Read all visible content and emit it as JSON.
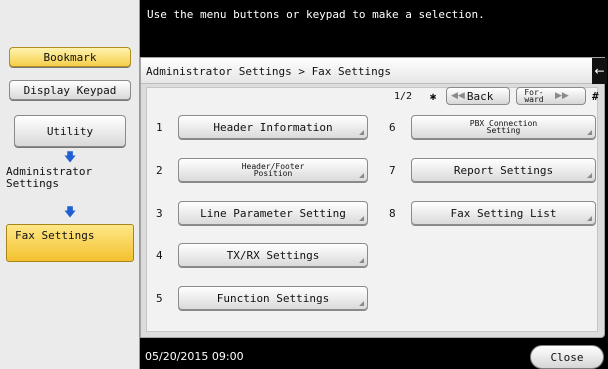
{
  "message": "Use the menu buttons or keypad to make a selection.",
  "sidebar": {
    "bookmark": "Bookmark",
    "display_keypad": "Display Keypad",
    "utility": "Utility",
    "administrator_settings": "Administrator\nSettings",
    "fax_settings": "Fax Settings",
    "arrow_color": "#2060d0",
    "highlight_color": "#f6cf4a"
  },
  "panel": {
    "breadcrumb": "Administrator Settings  > Fax Settings",
    "page_indicator": "1/2",
    "star": "✱",
    "back_label": "Back",
    "forward_label": "For-\nward",
    "hash": "#"
  },
  "options": [
    {
      "num": "1",
      "label": "Header Information"
    },
    {
      "num": "2",
      "label": "Header/Footer\nPosition"
    },
    {
      "num": "3",
      "label": "Line Parameter Setting"
    },
    {
      "num": "4",
      "label": "TX/RX Settings"
    },
    {
      "num": "5",
      "label": "Function Settings"
    },
    {
      "num": "6",
      "label": "PBX Connection\nSetting"
    },
    {
      "num": "7",
      "label": "Report Settings"
    },
    {
      "num": "8",
      "label": "Fax Setting List"
    }
  ],
  "footer": {
    "datetime": "05/20/2015  09:00",
    "close_label": "Close"
  }
}
